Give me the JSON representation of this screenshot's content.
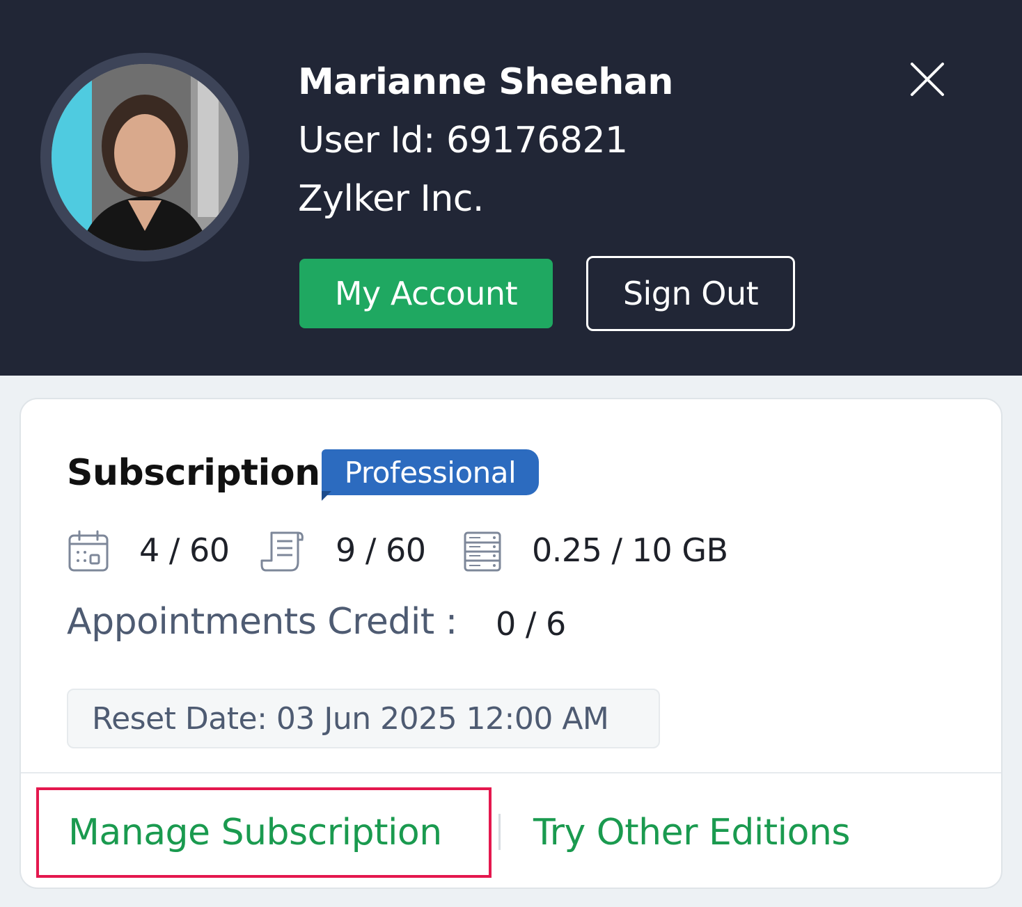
{
  "profile": {
    "name": "Marianne Sheehan",
    "user_id": "User Id: 69176821",
    "organization": "Zylker Inc.",
    "my_account_label": "My Account",
    "sign_out_label": "Sign Out",
    "close_icon": "close-icon"
  },
  "subscription": {
    "title": "Subscription",
    "edition_badge": "Professional",
    "stats": [
      {
        "icon": "calendar-icon",
        "value": "4 / 60"
      },
      {
        "icon": "document-icon",
        "value": "9 / 60"
      },
      {
        "icon": "storage-icon",
        "value": "0.25 / 10 GB"
      }
    ],
    "credit_label": "Appointments Credit :",
    "credit_value": "0 / 6",
    "reset_date": "Reset Date: 03 Jun 2025 12:00 AM"
  },
  "links": {
    "manage": "Manage Subscription",
    "try_other": "Try Other Editions"
  },
  "colors": {
    "header_bg": "#212636",
    "accent_green": "#1fa861",
    "link_green": "#1a9a4f",
    "badge_blue": "#2c6bbf",
    "highlight_red": "#e4184e"
  }
}
